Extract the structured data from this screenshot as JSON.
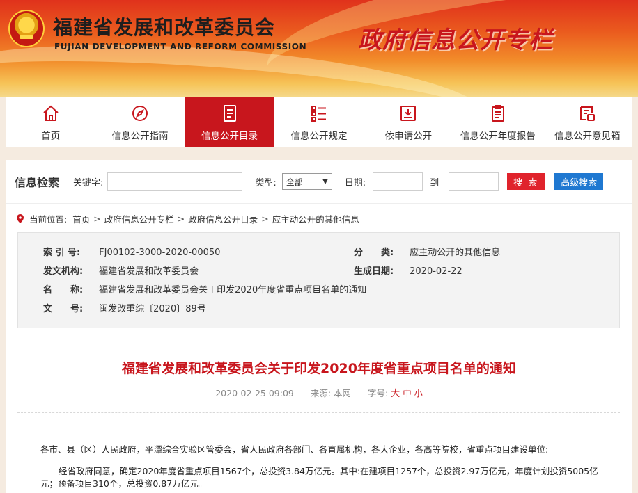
{
  "header": {
    "site_title": "福建省发展和改革委员会",
    "site_subtitle": "FUJIAN DEVELOPMENT AND REFORM COMMISSION",
    "zone_title": "政府信息公开专栏"
  },
  "nav": {
    "active_index": 2,
    "items": [
      {
        "label": "首页",
        "icon": "home-icon"
      },
      {
        "label": "信息公开指南",
        "icon": "compass-icon"
      },
      {
        "label": "信息公开目录",
        "icon": "document-list-icon"
      },
      {
        "label": "信息公开规定",
        "icon": "rules-list-icon"
      },
      {
        "label": "依申请公开",
        "icon": "inbox-download-icon"
      },
      {
        "label": "信息公开年度报告",
        "icon": "report-icon"
      },
      {
        "label": "信息公开意见箱",
        "icon": "feedback-box-icon"
      }
    ]
  },
  "search": {
    "title": "信息检索",
    "keyword_label": "关键字:",
    "keyword_value": "",
    "type_label": "类型:",
    "type_value": "全部",
    "date_label": "日期:",
    "date_from": "",
    "to_label": "到",
    "date_to": "",
    "search_button": "搜 索",
    "advanced_button": "高级搜索"
  },
  "breadcrumb": {
    "prefix": "当前位置:",
    "items": [
      "首页",
      "政府信息公开专栏",
      "政府信息公开目录",
      "应主动公开的其他信息"
    ],
    "separator": ">"
  },
  "meta": {
    "index_label": "索 引 号:",
    "index_value": "FJ00102-3000-2020-00050",
    "category_label": "分　　类:",
    "category_value": "应主动公开的其他信息",
    "issuer_label": "发文机构:",
    "issuer_value": "福建省发展和改革委员会",
    "date_label": "生成日期:",
    "date_value": "2020-02-22",
    "name_label": "名　　称:",
    "name_value": "福建省发展和改革委员会关于印发2020年度省重点项目名单的通知",
    "doc_no_label": "文　　号:",
    "doc_no_value": "闽发改重综〔2020〕89号"
  },
  "article": {
    "title": "福建省发展和改革委员会关于印发2020年度省重点项目名单的通知",
    "datetime": "2020-02-25 09:09",
    "source_label": "来源:",
    "source_value": "本网",
    "fontsize_label": "字号:",
    "size_large": "大",
    "size_medium": "中",
    "size_small": "小",
    "p1": "各市、县（区）人民政府，平潭综合实验区管委会，省人民政府各部门、各直属机构，各大企业，各高等院校，省重点项目建设单位:",
    "p2_line1": "经省政府同意，确定2020年度省重点项目1567个，总投资3.84万亿元。其中:在建项目1257个，总投资2.97万亿元，年度计划投资5005亿",
    "p2_line2": "元；预备项目310个，总投资0.87万亿元。"
  }
}
